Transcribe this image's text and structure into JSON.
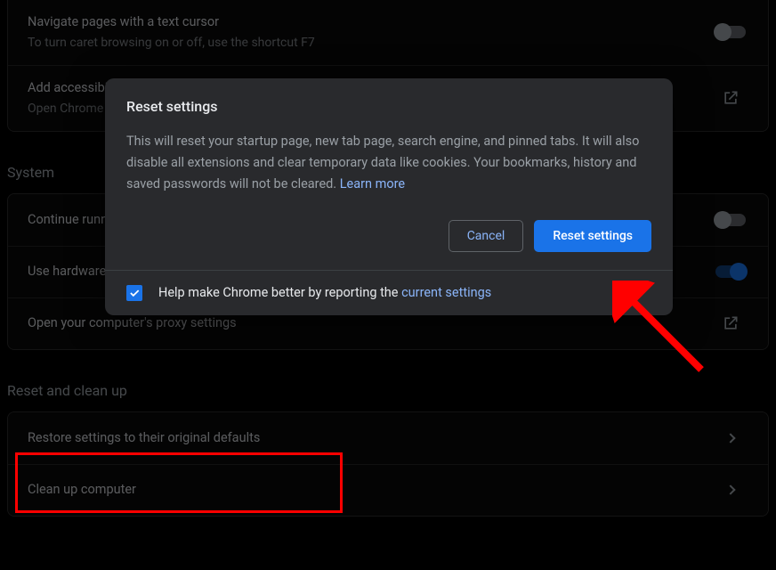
{
  "accessibility": {
    "caret_title": "Navigate pages with a text cursor",
    "caret_sub": "To turn caret browsing on or off, use the shortcut F7",
    "add_title": "Add accessibility features",
    "add_sub": "Open Chrome Web Store"
  },
  "system": {
    "heading": "System",
    "continue_label": "Continue running background apps when Google Chrome is closed",
    "hw_label": "Use hardware acceleration when available",
    "proxy_label": "Open your computer's proxy settings"
  },
  "reset_section": {
    "heading": "Reset and clean up",
    "restore_label": "Restore settings to their original defaults",
    "cleanup_label": "Clean up computer"
  },
  "dialog": {
    "title": "Reset settings",
    "body_text": "This will reset your startup page, new tab page, search engine, and pinned tabs. It will also disable all extensions and clear temporary data like cookies. Your bookmarks, history and saved passwords will not be cleared. ",
    "learn_more": "Learn more",
    "cancel": "Cancel",
    "confirm": "Reset settings",
    "footer_prefix": "Help make Chrome better by reporting the ",
    "footer_link": "current settings"
  }
}
